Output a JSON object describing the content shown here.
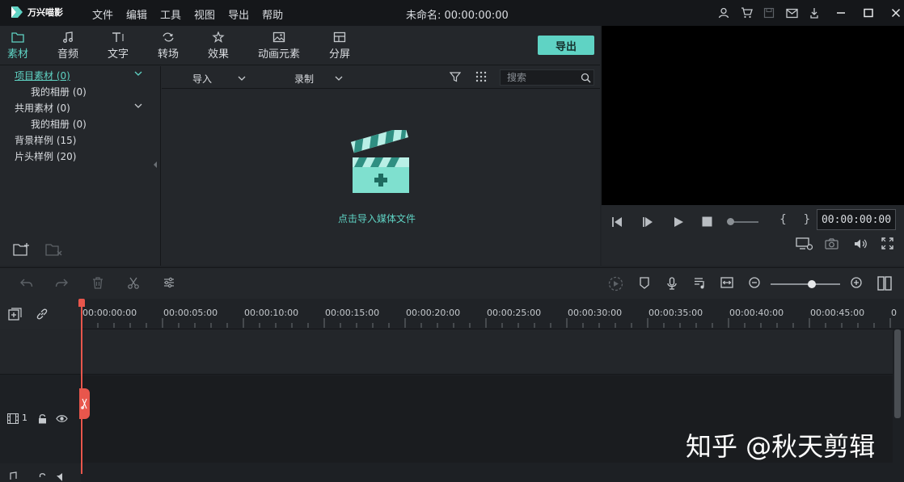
{
  "app": {
    "name": "万兴喵影",
    "doc_title": "未命名: 00:00:00:00"
  },
  "menu": [
    "文件",
    "编辑",
    "工具",
    "视图",
    "导出",
    "帮助"
  ],
  "library": {
    "tabs": [
      {
        "label": "素材",
        "icon": "folder-icon",
        "active": true
      },
      {
        "label": "音频",
        "icon": "music-note-icon"
      },
      {
        "label": "文字",
        "icon": "text-icon"
      },
      {
        "label": "转场",
        "icon": "transition-icon"
      },
      {
        "label": "效果",
        "icon": "effects-icon"
      },
      {
        "label": "动画元素",
        "icon": "image-icon"
      },
      {
        "label": "分屏",
        "icon": "split-screen-icon"
      }
    ],
    "export_label": "导出",
    "tree": [
      {
        "label": "项目素材 (0)",
        "active": true,
        "expandable": true
      },
      {
        "label": "我的相册 (0)",
        "indent": true
      },
      {
        "label": "共用素材 (0)",
        "expandable": true
      },
      {
        "label": "我的相册 (0)",
        "indent": true
      },
      {
        "label": "背景样例 (15)"
      },
      {
        "label": "片头样例 (20)"
      }
    ],
    "import_label": "导入",
    "record_label": "录制",
    "search_placeholder": "搜索",
    "empty_hint": "点击导入媒体文件"
  },
  "preview": {
    "timecode": "00:00:00:00",
    "brackets": "{ }"
  },
  "timeline": {
    "ruler_labels": [
      "00:00:00:00",
      "00:00:05:00",
      "00:00:10:00",
      "00:00:15:00",
      "00:00:20:00",
      "00:00:25:00",
      "00:00:30:00",
      "00:00:35:00",
      "00:00:40:00",
      "00:00:45:00",
      "0"
    ],
    "video_track_number": "1"
  },
  "watermark": "知乎 @秋天剪辑",
  "colors": {
    "accent": "#5fd3c4",
    "playhead": "#e8564c",
    "panel": "#24272b",
    "titlebar": "#15171a"
  }
}
